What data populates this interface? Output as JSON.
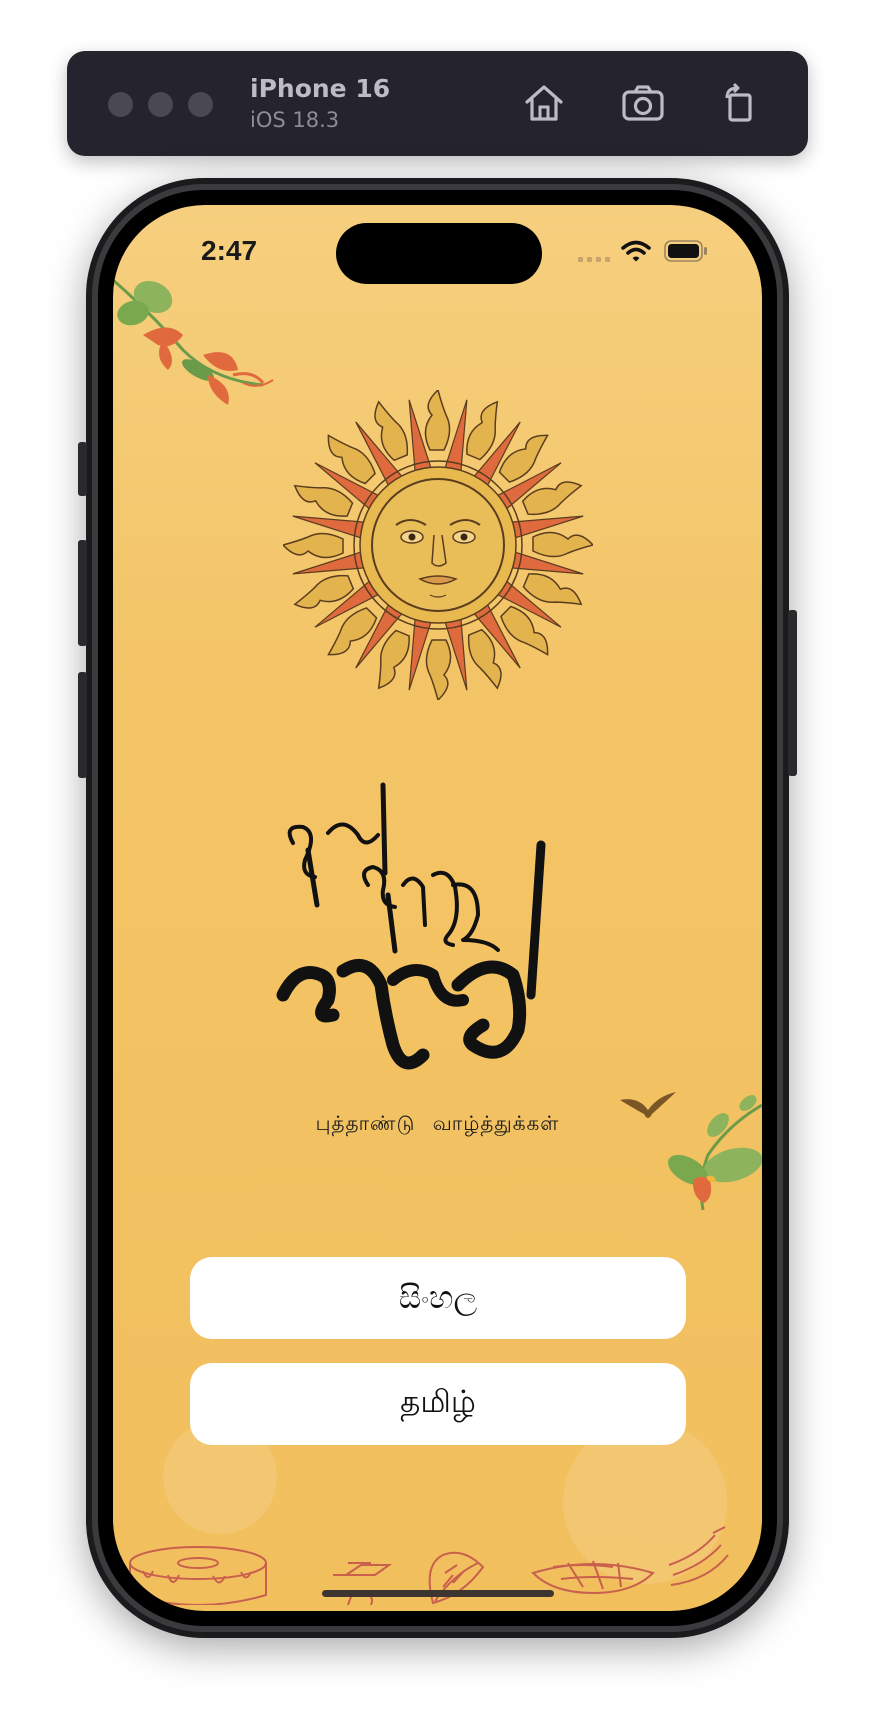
{
  "simulator": {
    "device_name": "iPhone 16",
    "os_version": "iOS 18.3",
    "icons": [
      "home-icon",
      "screenshot-icon",
      "rotate-icon"
    ]
  },
  "status_bar": {
    "time": "2:47",
    "icons": [
      "cellular-icon",
      "wifi-icon",
      "battery-icon"
    ]
  },
  "main": {
    "logo_text": "අලුත් අවුරුදු නැකැත",
    "subtitle": "புத்தாண்டு  வாழ்த்துக்கள்",
    "buttons": [
      {
        "label": "සිංහල"
      },
      {
        "label": "தமிழ்"
      }
    ]
  },
  "colors": {
    "background_top": "#f6cf7e",
    "background_bottom": "#f2bf5d",
    "sun_ray": "#de6a3e",
    "sun_gold": "#e3b34d",
    "button_bg": "#ffffff"
  }
}
